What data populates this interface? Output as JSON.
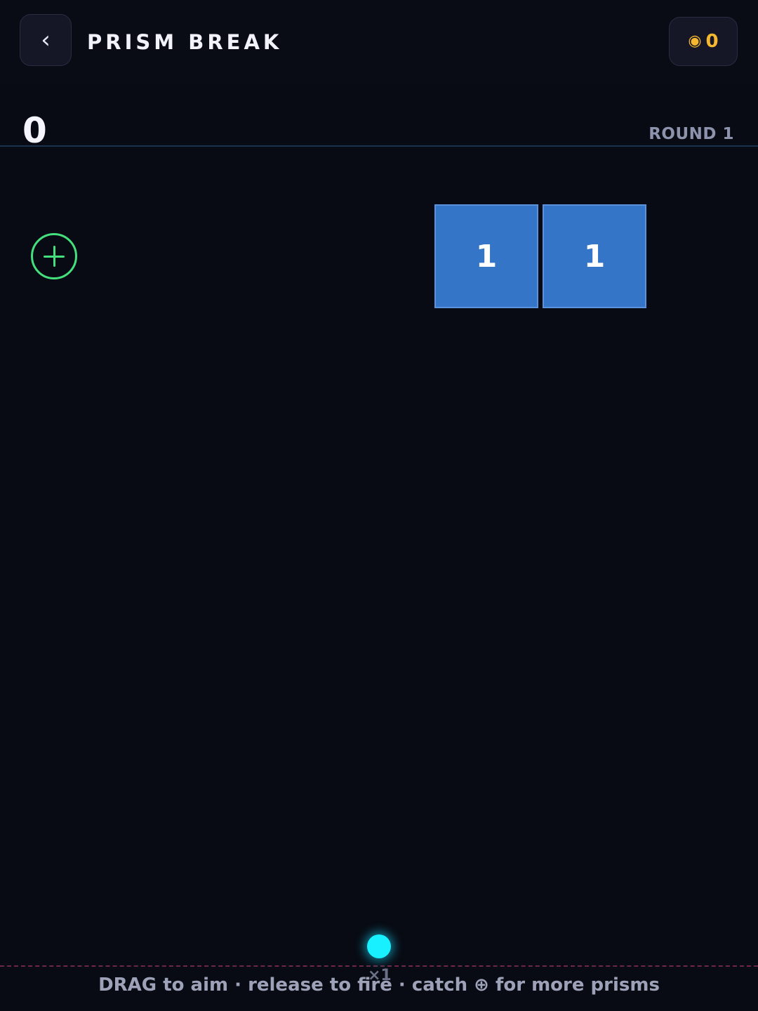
{
  "header": {
    "back_label": "‹",
    "title": "PRISM BREAK",
    "coins": {
      "icon": "coin-icon",
      "icon_glyph": "◉",
      "value": "0",
      "color": "#f5b82e"
    }
  },
  "hud": {
    "score": "0",
    "round_label": "ROUND 1"
  },
  "board": {
    "blocks": [
      {
        "hits": "1",
        "color": "#3575c7"
      },
      {
        "hits": "1",
        "color": "#3575c7"
      }
    ],
    "pickup": {
      "icon": "plus-circle-icon",
      "color": "#44e07e"
    },
    "launcher": {
      "ball_color": "#18f0ff",
      "ball_count": "×1"
    }
  },
  "footer": {
    "hint": "DRAG to aim · release to fire · catch ⊕ for more prisms"
  }
}
